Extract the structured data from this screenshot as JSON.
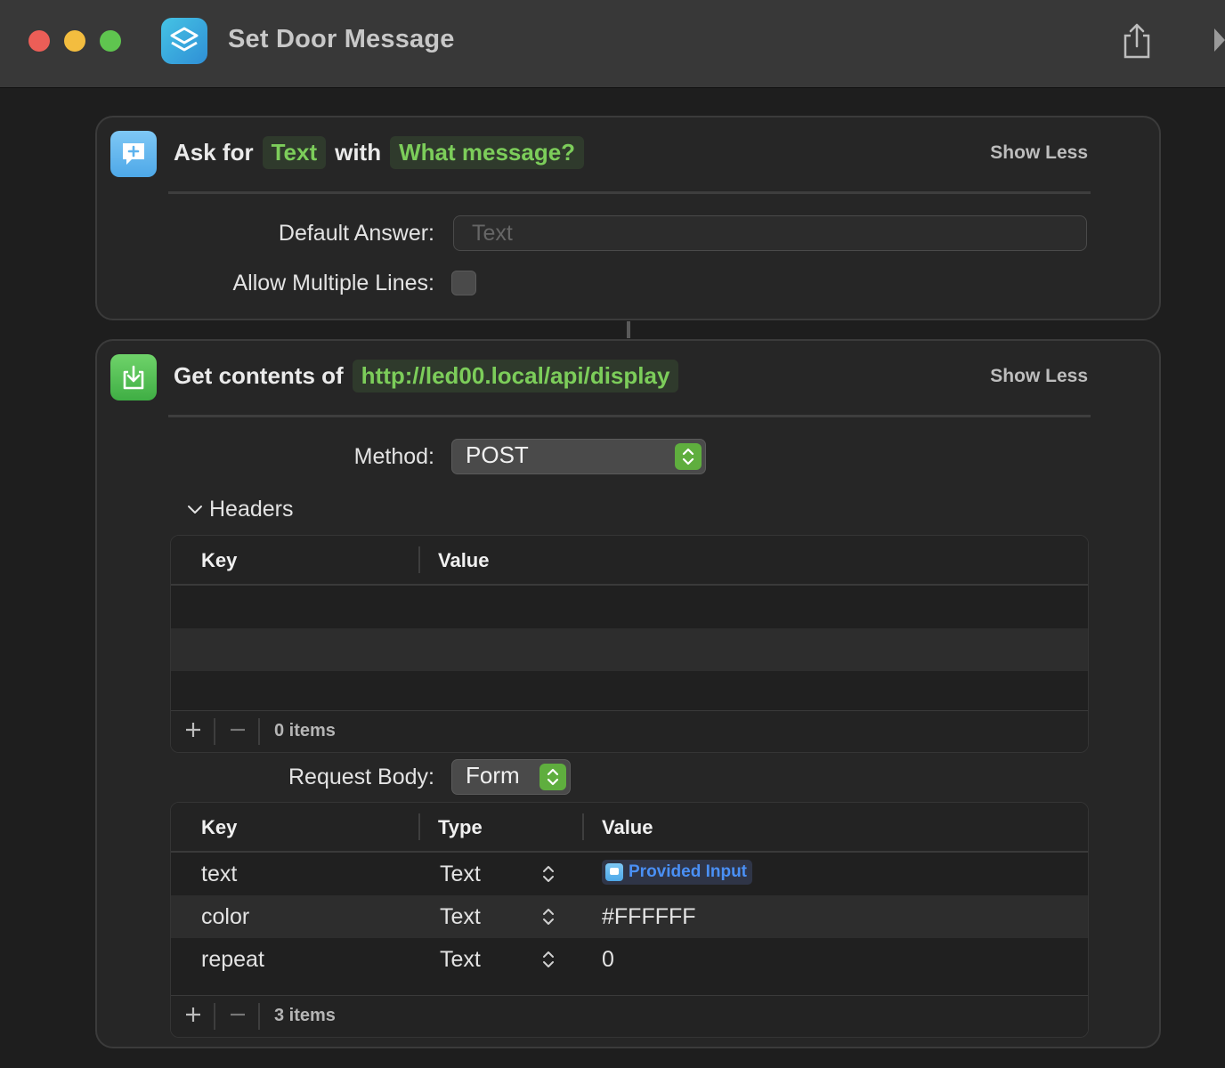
{
  "window": {
    "title": "Set Door Message",
    "app_icon": "shortcuts-icon",
    "toolbar_icons": [
      "share-icon",
      "run-icon"
    ]
  },
  "ask_action": {
    "prefix": "Ask for",
    "type_token": "Text",
    "joiner": "with",
    "prompt_token": "What message?",
    "show_less": "Show Less",
    "default_answer_label": "Default Answer:",
    "default_answer_placeholder": "Text",
    "allow_multiple_label": "Allow Multiple Lines:",
    "allow_multiple_checked": false,
    "icon": "ask-input-icon"
  },
  "get_action": {
    "prefix": "Get contents of",
    "url_token": "http://led00.local/api/display",
    "show_less": "Show Less",
    "method_label": "Method:",
    "method_value": "POST",
    "headers_label": "Headers",
    "headers_table": {
      "columns": [
        "Key",
        "Value"
      ],
      "count_label": "0 items"
    },
    "request_body_label": "Request Body:",
    "request_body_value": "Form",
    "body_table": {
      "columns": [
        "Key",
        "Type",
        "Value"
      ],
      "rows": [
        {
          "key": "text",
          "type": "Text",
          "value": "Provided Input"
        },
        {
          "key": "color",
          "type": "Text",
          "value": "#FFFFFF"
        },
        {
          "key": "repeat",
          "type": "Text",
          "value": "0"
        }
      ],
      "count_label": "3 items"
    },
    "icon": "download-icon"
  },
  "colors": {
    "token_green": "#7ccd5a",
    "variable_blue": "#4a90f5",
    "stepper_green": "#5fae3e"
  }
}
